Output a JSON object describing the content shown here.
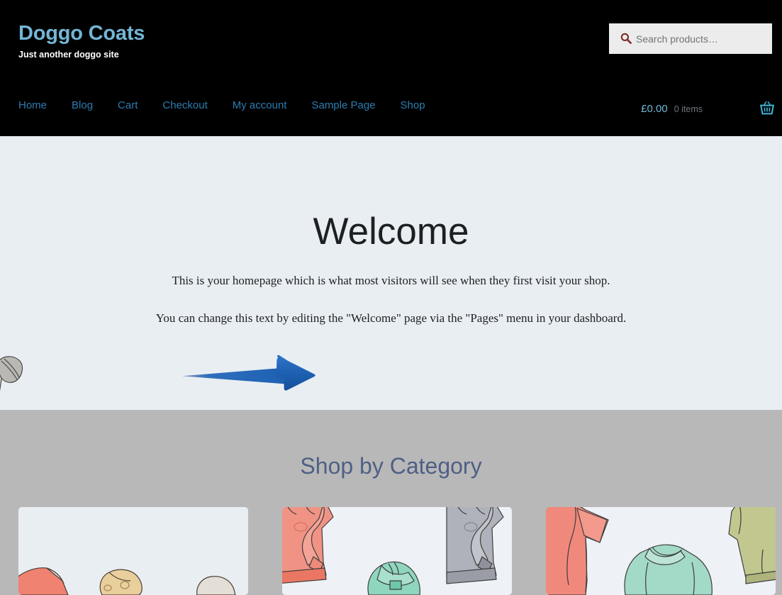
{
  "site": {
    "title": "Doggo Coats",
    "tagline": "Just another doggo site",
    "brand_color": "#72b6d6",
    "header_bg": "#000000",
    "content_bg": "#e9eef2",
    "category_band_bg": "#b8b8b8"
  },
  "search": {
    "placeholder": "Search products…",
    "value": "",
    "icon": "search-icon",
    "icon_color": "#7f2e23",
    "field_bg": "#ececed"
  },
  "nav": {
    "items": [
      {
        "label": "Home"
      },
      {
        "label": "Blog"
      },
      {
        "label": "Cart"
      },
      {
        "label": "Checkout"
      },
      {
        "label": "My account"
      },
      {
        "label": "Sample Page"
      },
      {
        "label": "Shop"
      }
    ],
    "link_color": "#2c7cb0"
  },
  "cart": {
    "total": "£0.00",
    "count": "0 items",
    "icon": "shopping-basket-icon",
    "icon_color": "#3fb6d8",
    "total_color": "#6fb7d8",
    "count_color": "#707579"
  },
  "hero": {
    "title": "Welcome",
    "paragraphs": [
      "This is your homepage which is what most visitors will see when they first visit your shop.",
      "You can change this text by editing the \"Welcome\" page via the \"Pages\" menu in your dashboard."
    ]
  },
  "annotation": {
    "type": "arrow",
    "direction": "right",
    "color": "#2065b8",
    "color_dark": "#12499a",
    "points_to": "Welcome"
  },
  "category_section": {
    "heading": "Shop by Category",
    "heading_color": "#4f5f85",
    "cards": [
      {
        "name": "category-card-1",
        "art": "illustrated-garments-red-tan",
        "colors": [
          "#ef8271",
          "#e8cf9c",
          "#e9eef2"
        ]
      },
      {
        "name": "category-card-2",
        "art": "illustrated-hoodies-salmon-mint-grey",
        "colors": [
          "#f09384",
          "#8fd6be",
          "#b0b2bb",
          "#eef1f5"
        ]
      },
      {
        "name": "category-card-3",
        "art": "illustrated-tshirts-salmon-mint-olive",
        "colors": [
          "#f0897c",
          "#a3d9c7",
          "#c2c78f",
          "#eef1f5"
        ]
      }
    ]
  },
  "edge_illustration": {
    "name": "cut-off-grey-hooded-garment",
    "colors": [
      "#cfcdc8",
      "#a9a8a4",
      "#3c3c3c"
    ]
  }
}
